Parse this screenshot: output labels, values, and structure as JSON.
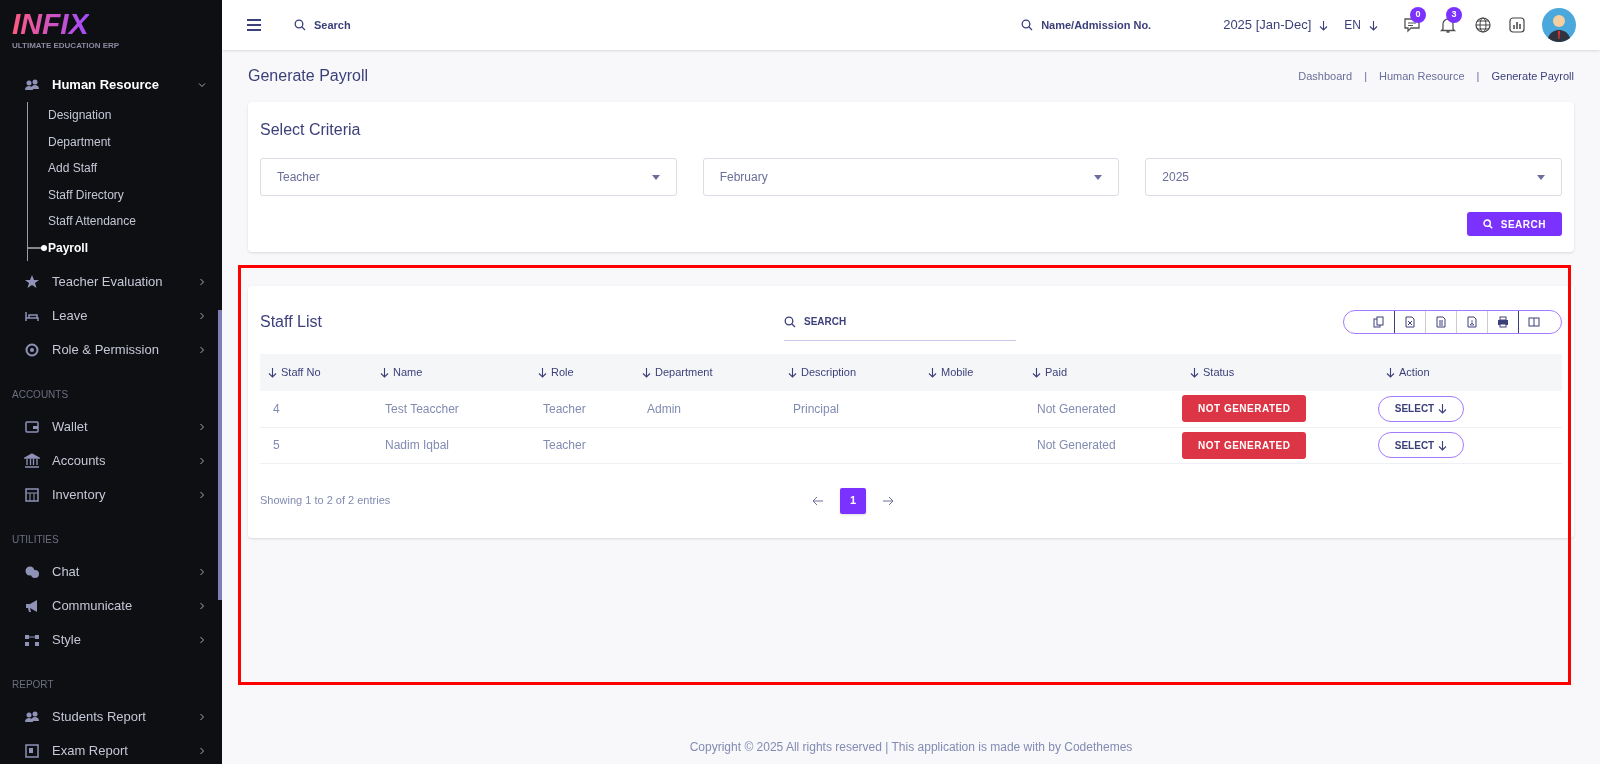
{
  "logo": {
    "text": "INFIX",
    "subtitle": "ULTIMATE EDUCATION ERP"
  },
  "sidebar": {
    "items": [
      {
        "kind": "menu",
        "label": "Human Resource",
        "expanded": true,
        "children": [
          {
            "label": "Designation",
            "selected": false
          },
          {
            "label": "Department",
            "selected": false
          },
          {
            "label": "Add Staff",
            "selected": false
          },
          {
            "label": "Staff Directory",
            "selected": false
          },
          {
            "label": "Staff Attendance",
            "selected": false
          },
          {
            "label": "Payroll",
            "selected": true
          }
        ]
      },
      {
        "kind": "menu",
        "label": "Teacher Evaluation",
        "expanded": false
      },
      {
        "kind": "menu",
        "label": "Leave",
        "expanded": false
      },
      {
        "kind": "menu",
        "label": "Role & Permission",
        "expanded": false
      },
      {
        "kind": "section",
        "label": "ACCOUNTS"
      },
      {
        "kind": "menu",
        "label": "Wallet",
        "expanded": false
      },
      {
        "kind": "menu",
        "label": "Accounts",
        "expanded": false
      },
      {
        "kind": "menu",
        "label": "Inventory",
        "expanded": false
      },
      {
        "kind": "section",
        "label": "UTILITIES"
      },
      {
        "kind": "menu",
        "label": "Chat",
        "expanded": false
      },
      {
        "kind": "menu",
        "label": "Communicate",
        "expanded": false
      },
      {
        "kind": "menu",
        "label": "Style",
        "expanded": false
      },
      {
        "kind": "section",
        "label": "REPORT"
      },
      {
        "kind": "menu",
        "label": "Students Report",
        "expanded": false
      },
      {
        "kind": "menu",
        "label": "Exam Report",
        "expanded": false
      }
    ]
  },
  "topbar": {
    "search_placeholder": "Search",
    "student_search_placeholder": "Name/Admission No.",
    "session": "2025 [Jan-Dec]",
    "language": "EN",
    "messages_count": "0",
    "notifications_count": "3"
  },
  "page": {
    "title": "Generate Payroll",
    "breadcrumb": [
      "Dashboard",
      "Human Resource",
      "Generate Payroll"
    ],
    "breadcrumb_separator": "|"
  },
  "criteria": {
    "title": "Select Criteria",
    "selects": [
      "Teacher",
      "February",
      "2025"
    ],
    "button": "SEARCH"
  },
  "staff_list": {
    "title": "Staff List",
    "search_placeholder": "SEARCH",
    "columns": [
      "Staff No",
      "Name",
      "Role",
      "Department",
      "Description",
      "Mobile",
      "Paid",
      "Status",
      "Action"
    ],
    "rows": [
      {
        "staff_no": "4",
        "name": "Test Teaccher",
        "role": "Teacher",
        "department": "Admin",
        "description": "Principal",
        "paid": "Not Generated",
        "status": "NOT GENERATED",
        "action": "SELECT"
      },
      {
        "staff_no": "5",
        "name": "Nadim Iqbal",
        "role": "Teacher",
        "paid": "Not Generated",
        "status": "NOT GENERATED",
        "action": "SELECT"
      }
    ],
    "info": "Showing 1 to 2 of 2 entries",
    "pages": [
      {
        "label": "1",
        "selected": true
      }
    ]
  },
  "footer": "Copyright © 2025 All rights reserved | This application is made with by Codethemes"
}
